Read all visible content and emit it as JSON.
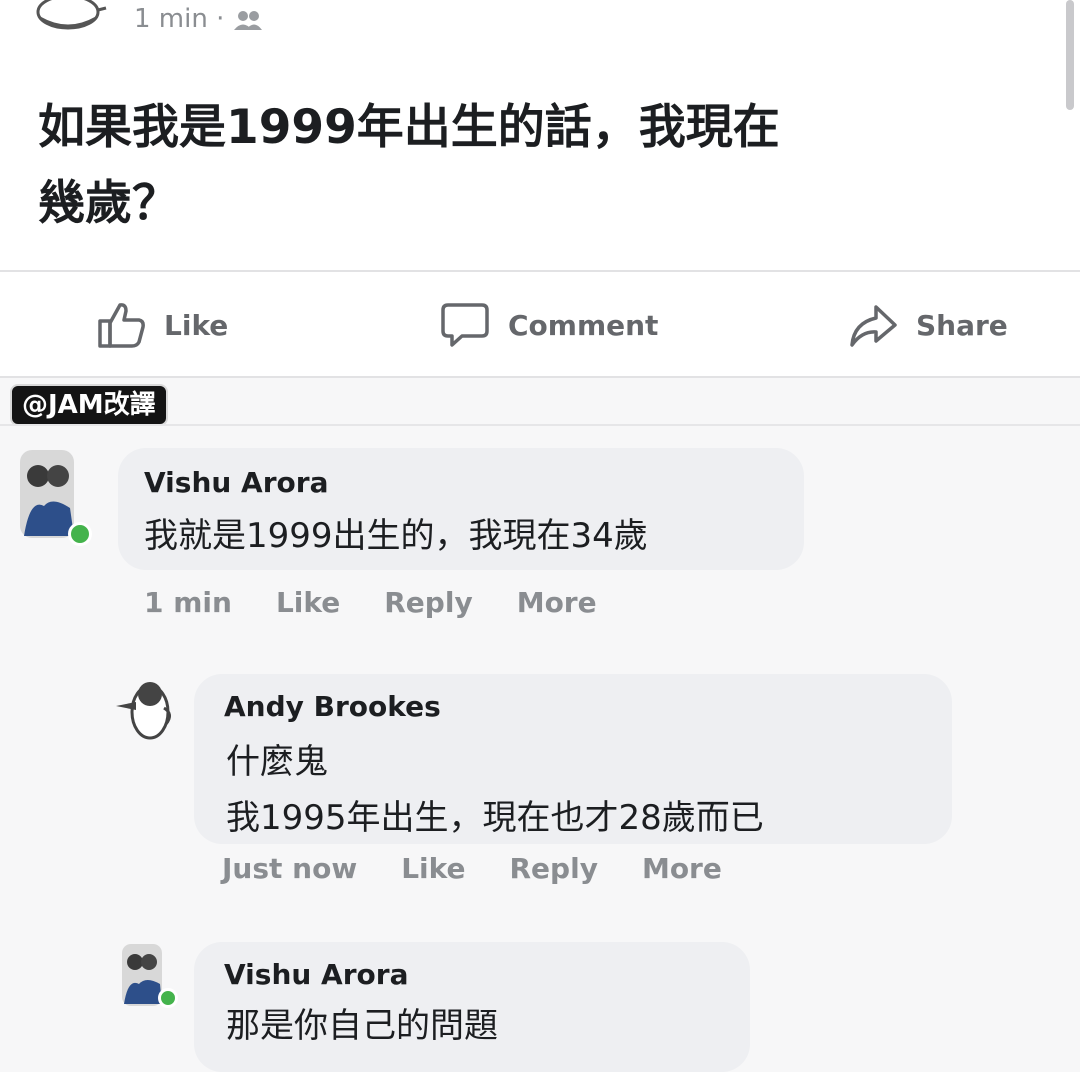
{
  "post": {
    "time": "1 min · ",
    "privacy_icon": "friends-icon",
    "text_line1": "如果我是1999年出生的話，我現在",
    "text_line2": "幾歲？"
  },
  "actions": {
    "like": "Like",
    "comment": "Comment",
    "share": "Share"
  },
  "watermark": "@JAM改譯",
  "comments": [
    {
      "name": "Vishu Arora",
      "text": "我就是1999出生的，我現在34歲",
      "time": "1 min",
      "like": "Like",
      "reply": "Reply",
      "more": "More"
    },
    {
      "name": "Andy Brookes",
      "text_line1": "什麼鬼",
      "text_line2": "我1995年出生，現在也才28歲而已",
      "time": "Just now",
      "like": "Like",
      "reply": "Reply",
      "more": "More"
    },
    {
      "name": "Vishu Arora",
      "text": "那是你自己的問題"
    }
  ],
  "colors": {
    "online": "#44b34c",
    "meta": "#8a8d91",
    "bubble": "#eeeff2"
  }
}
